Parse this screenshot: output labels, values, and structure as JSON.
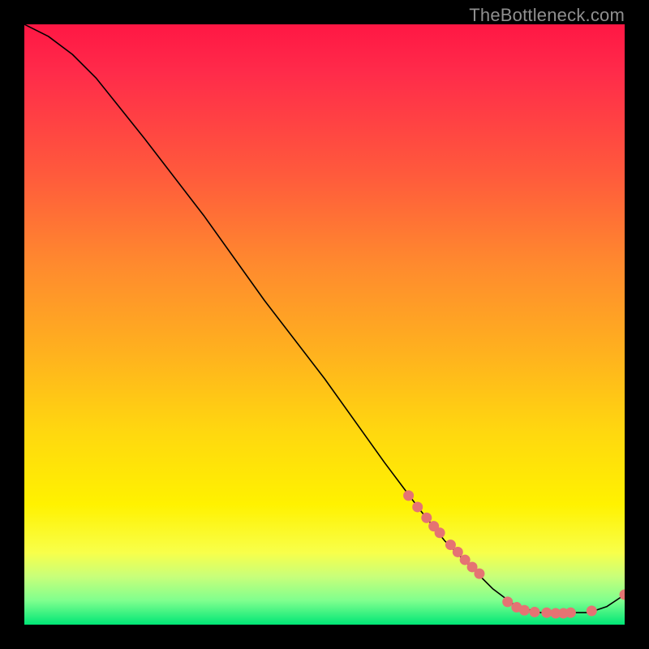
{
  "watermark": "TheBottleneck.com",
  "chart_data": {
    "type": "line",
    "title": "",
    "xlabel": "",
    "ylabel": "",
    "xlim": [
      0,
      100
    ],
    "ylim": [
      0,
      100
    ],
    "grid": false,
    "legend": false,
    "series": [
      {
        "name": "curve",
        "stroke": "#000000",
        "x": [
          0,
          4,
          8,
          12,
          20,
          30,
          40,
          50,
          60,
          66,
          70,
          74,
          78,
          82,
          86,
          90,
          94,
          97,
          100
        ],
        "y": [
          100,
          98,
          95,
          91,
          81,
          68,
          54,
          41,
          27,
          19,
          14,
          10,
          6,
          3,
          2,
          2,
          2,
          3,
          5
        ]
      }
    ],
    "markers": {
      "name": "dots",
      "color": "#e57373",
      "radius": 6.5,
      "points": [
        {
          "x": 64,
          "y": 21.5
        },
        {
          "x": 65.5,
          "y": 19.6
        },
        {
          "x": 67,
          "y": 17.8
        },
        {
          "x": 68.2,
          "y": 16.4
        },
        {
          "x": 69.2,
          "y": 15.3
        },
        {
          "x": 71,
          "y": 13.3
        },
        {
          "x": 72.2,
          "y": 12.1
        },
        {
          "x": 73.4,
          "y": 10.8
        },
        {
          "x": 74.6,
          "y": 9.6
        },
        {
          "x": 75.8,
          "y": 8.5
        },
        {
          "x": 80.5,
          "y": 3.8
        },
        {
          "x": 82,
          "y": 2.9
        },
        {
          "x": 83.3,
          "y": 2.4
        },
        {
          "x": 85,
          "y": 2.1
        },
        {
          "x": 87,
          "y": 2.0
        },
        {
          "x": 88.5,
          "y": 1.9
        },
        {
          "x": 89.8,
          "y": 1.9
        },
        {
          "x": 91,
          "y": 2.0
        },
        {
          "x": 94.5,
          "y": 2.3
        },
        {
          "x": 100,
          "y": 5.0
        }
      ]
    }
  }
}
